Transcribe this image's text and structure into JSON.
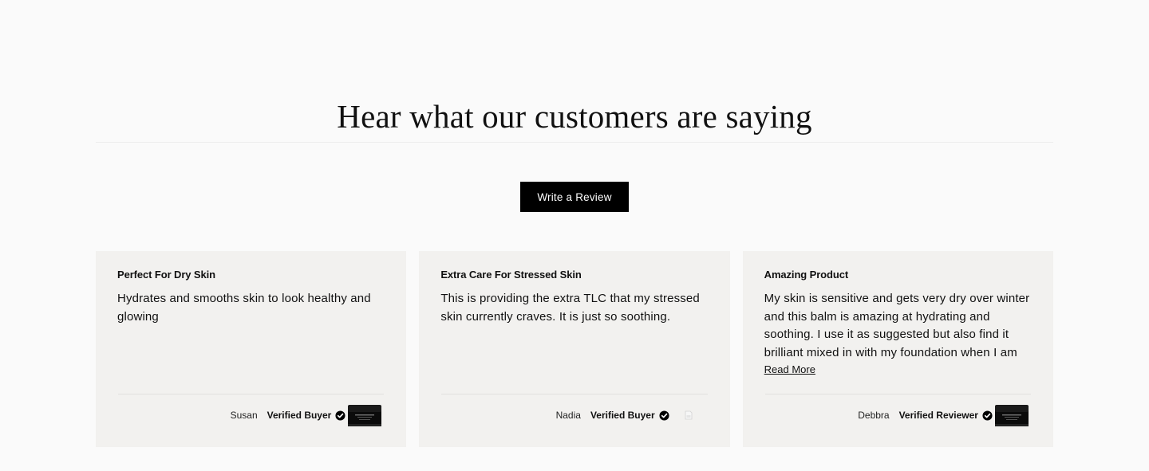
{
  "section": {
    "heading": "Hear what our customers are saying",
    "write_review_label": "Write a Review"
  },
  "reviews": [
    {
      "title": "Perfect For Dry Skin",
      "body": "Hydrates and smooths skin to look healthy and glowing",
      "reviewer": "Susan",
      "badge": "Verified Buyer",
      "has_read_more": false,
      "product_image": "product-jar"
    },
    {
      "title": "Extra Care For Stressed Skin",
      "body": "This is providing the extra TLC that my stressed skin currently craves. It is just so soothing.",
      "reviewer": "Nadia",
      "badge": "Verified Buyer",
      "has_read_more": false,
      "product_image": "broken-image"
    },
    {
      "title": "Amazing Product",
      "body": "My skin is sensitive and gets very dry over winter and this balm is amazing at hydrating and soothing. I use it as suggested but also find it brilliant mixed in with my foundation when I am",
      "reviewer": "Debbra",
      "badge": "Verified Reviewer",
      "has_read_more": true,
      "read_more_label": "Read More",
      "product_image": "product-jar"
    }
  ],
  "colors": {
    "page_bg": "#fafafa",
    "card_bg": "#f2f1ef",
    "button_bg": "#000000",
    "button_text": "#ffffff"
  }
}
